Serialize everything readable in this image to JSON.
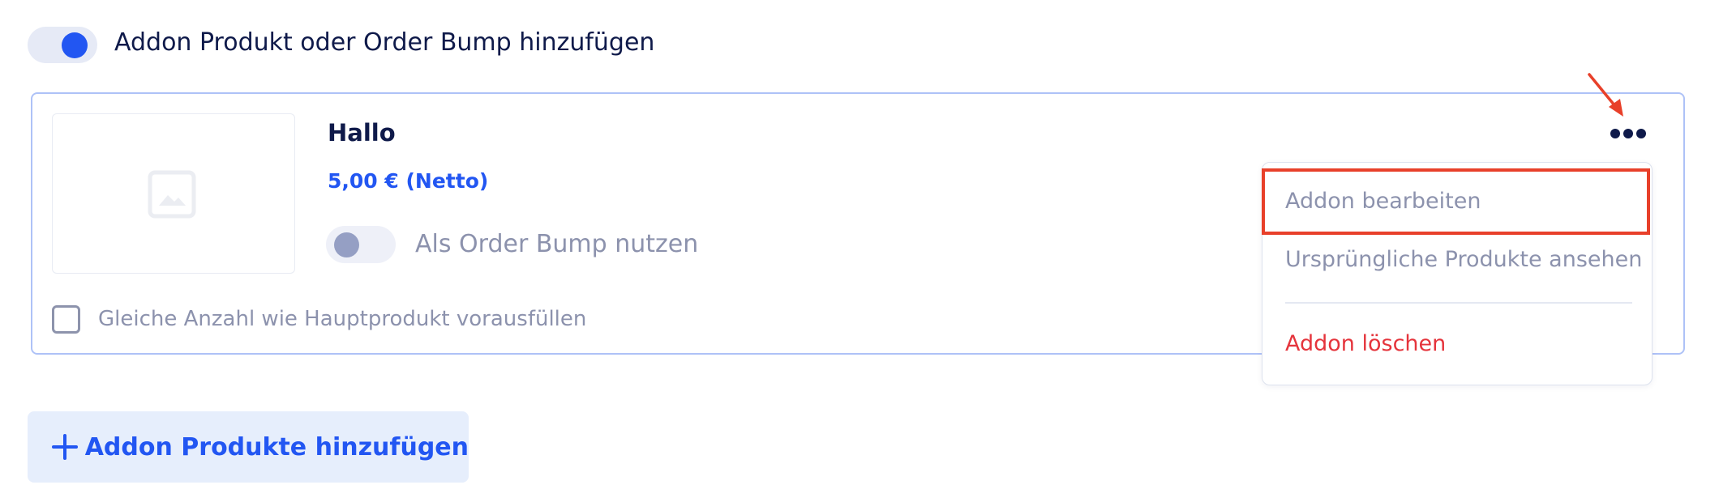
{
  "addon_toggle": {
    "label": "Addon Produkt oder Order Bump hinzufügen",
    "enabled": true
  },
  "addon": {
    "title": "Hallo",
    "price": "5,00 € (Netto)",
    "order_bump": {
      "label": "Als Order Bump nutzen",
      "enabled": false
    },
    "prefill_checkbox": {
      "label": "Gleiche Anzahl wie Hauptprodukt vorausfüllen",
      "checked": false
    }
  },
  "more_menu": {
    "icon": "more-horizontal-icon",
    "items": [
      {
        "label": "Addon bearbeiten",
        "highlighted": true
      },
      {
        "label": "Ursprüngliche Produkte ansehen"
      },
      {
        "label": "Addon löschen",
        "danger": true
      }
    ]
  },
  "add_button": {
    "label": "Addon Produkte hinzufügen",
    "icon": "plus-icon"
  },
  "colors": {
    "accent": "#2256f2",
    "text_dark": "#0f1a4a",
    "text_muted": "#8c92ad",
    "danger": "#e5343c",
    "annotation": "#e8402a"
  }
}
